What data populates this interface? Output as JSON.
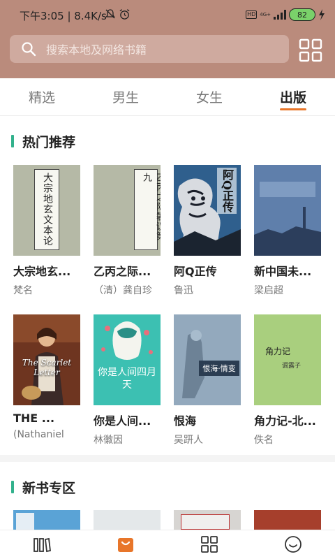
{
  "status_bar": {
    "time": "下午3:05 | 8.4K/s",
    "hd": "HD",
    "net": "4G+",
    "battery": "82"
  },
  "search": {
    "placeholder": "搜索本地及网络书籍"
  },
  "tabs": [
    {
      "label": "精选",
      "active": false
    },
    {
      "label": "男生",
      "active": false
    },
    {
      "label": "女生",
      "active": false
    },
    {
      "label": "出版",
      "active": true
    }
  ],
  "sections": [
    {
      "title": "热门推荐",
      "books": [
        {
          "title": "大宗地玄...",
          "author": "梵名"
        },
        {
          "title": "乙丙之际...",
          "author": "（清）龚自珍"
        },
        {
          "title": "阿Q正传",
          "author": "鲁迅"
        },
        {
          "title": "新中国未...",
          "author": "梁启超"
        },
        {
          "title": "THE ...",
          "author": "(Nathaniel"
        },
        {
          "title": "你是人间...",
          "author": "林徽因"
        },
        {
          "title": "恨海",
          "author": "吴趼人"
        },
        {
          "title": "角力记-北...",
          "author": "佚名"
        }
      ]
    },
    {
      "title": "新书专区"
    }
  ],
  "covers": {
    "c1_text": "大宗地玄文本论",
    "c2_text": "乙丙之际箸议第九",
    "c3_text": "阿Q正传",
    "c5_text": "The Scarlet Letter",
    "c6_text": "你是人间四月天",
    "c7_text": "恨海·情变",
    "c8_text": "角力记",
    "c8_sub": "调露子"
  },
  "colors": {
    "header": "#ba8b7c",
    "accent": "#e8762a",
    "section_bar": "#32b18c"
  }
}
